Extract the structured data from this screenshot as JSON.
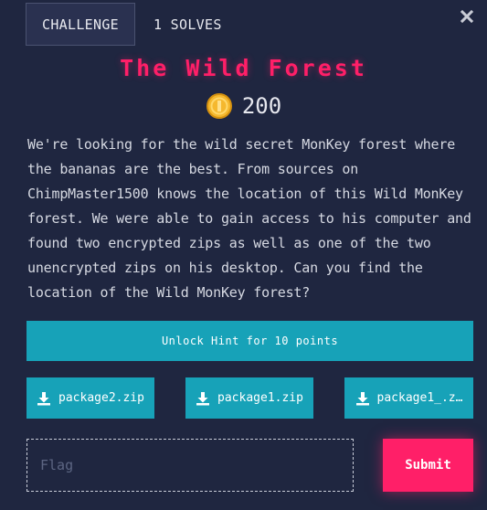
{
  "tabs": [
    {
      "label": "CHALLENGE",
      "active": true
    },
    {
      "label": "1 SOLVES",
      "active": false
    }
  ],
  "challenge": {
    "title": "The Wild Forest",
    "points": "200",
    "description": "We're looking for the wild secret MonKey forest where the bananas are the best. From sources on ChimpMaster1500 knows the location of this Wild MonKey forest. We were able to gain access to his computer and found two encrypted zips as well as one of the two unencrypted zips on his desktop. Can you find the location of the Wild MonKey forest?"
  },
  "hint": {
    "label": "Unlock Hint for 10 points"
  },
  "files": [
    {
      "label": "package2.zip",
      "icon": "download-icon"
    },
    {
      "label": "package1.zip",
      "icon": "download-icon"
    },
    {
      "label": "package1_.z…",
      "icon": "download-icon"
    }
  ],
  "flag": {
    "placeholder": "Flag",
    "value": ""
  },
  "submit": {
    "label": "Submit"
  },
  "icons": {
    "close": "close-icon",
    "coin": "coin-icon"
  },
  "colors": {
    "background": "#1f2640",
    "accent_pink": "#ff1f68",
    "button_teal": "#17a2b8",
    "coin_gold": "#f5b82e"
  }
}
